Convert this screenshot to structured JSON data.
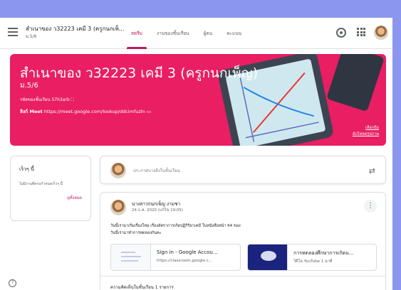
{
  "header": {
    "class_title": "สำเนาของ ว32223 เคมี 3 (ครูกนกเพ็...",
    "class_section": "ม.5/6",
    "tabs": [
      {
        "label": "สตรีม",
        "active": true
      },
      {
        "label": "งานของชั้นเรียน",
        "active": false
      },
      {
        "label": "ผู้คน",
        "active": false
      },
      {
        "label": "คะแนน",
        "active": false
      }
    ],
    "icons": [
      "menu-icon",
      "gear-icon",
      "apps-icon",
      "avatar"
    ]
  },
  "banner": {
    "title": "สำเนาของ ว32223 เคมี 3 (ครูกนกเพ็ญ)",
    "section": "ม.5/6",
    "class_code_label": "รหัสของชั้นเรียน",
    "class_code": "57h3arb",
    "meet_label": "ลิงก์ Meet",
    "meet_url": "https://meet.google.com/lookup/ddcimfuzln",
    "select_theme": "เลือกธีม",
    "upload_photo": "อัปโหลดรูปภาพ",
    "color": "#e91e63"
  },
  "side_card": {
    "title": "เร็วๆ นี้",
    "body": "ไม่มีงานที่ครบกำหนดเร็วๆ นี้",
    "link": "ดูทั้งหมด"
  },
  "share": {
    "placeholder": "ประกาศบางสิ่งในชั้นเรียน"
  },
  "post": {
    "author": "นางสาวกนกเพ็ญ งามชา",
    "date": "24 ธ.ค. 2020 (แก้ไข 19:05)",
    "line1": "วันนี้เรามาเริ่มเรื่องใหม่ เรื่องอัตราการเกิดปฏิกิริยาเคมี ในหนังสือหน้า 64 ของ",
    "line2": "วันนี้เรามาทำการทดลองกันคะ",
    "attachments": [
      {
        "title": "Sign in - Google Accou...",
        "sub": "https://classroom.google.c..."
      },
      {
        "title": "การทดลองศึกษาการเกิดแ...",
        "sub": "วิดีโอ YouTube  1 นาที"
      }
    ],
    "comments": "ความคิดเห็นในชั้นเรียน 1 รายการ"
  },
  "accent_color": "#c2185b"
}
